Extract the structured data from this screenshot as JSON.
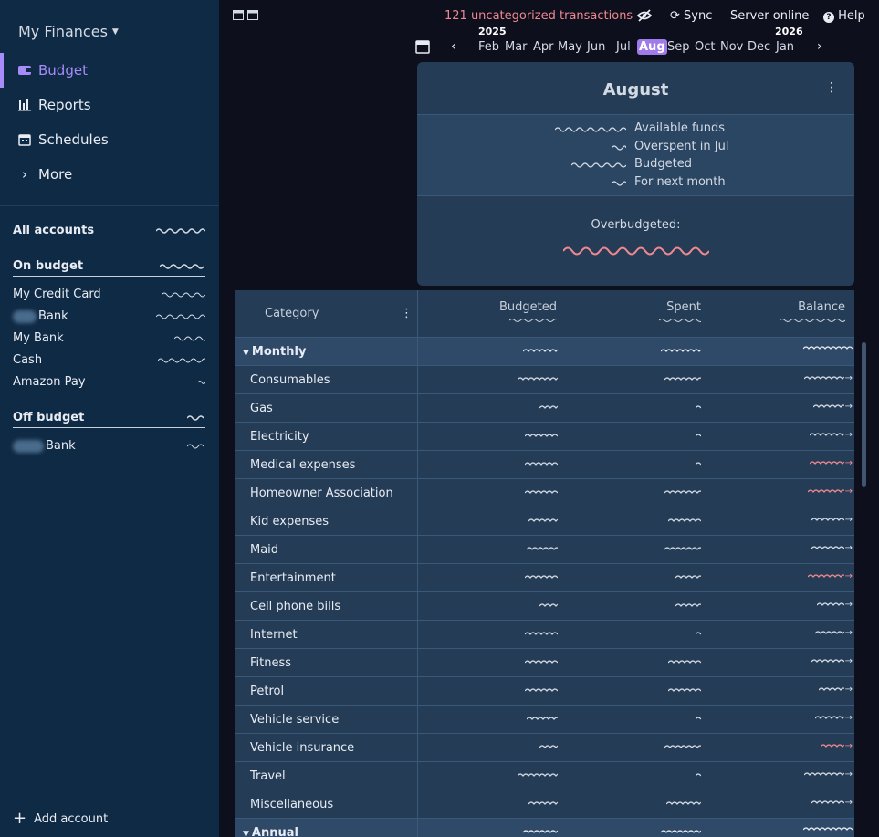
{
  "app": {
    "title": "My Finances"
  },
  "sidebar": {
    "nav": [
      {
        "label": "Budget",
        "icon": "wallet-icon",
        "active": true
      },
      {
        "label": "Reports",
        "icon": "chart-icon",
        "active": false
      },
      {
        "label": "Schedules",
        "icon": "calendar-icon",
        "active": false
      },
      {
        "label": "More",
        "icon": "chevron-right-icon",
        "active": false
      }
    ],
    "all_accounts": "All accounts",
    "on_budget": "On budget",
    "off_budget": "Off budget",
    "on_budget_accounts": [
      "My Credit Card",
      "Bank",
      "My Bank",
      "Cash",
      "Amazon Pay"
    ],
    "off_budget_accounts": [
      "Bank"
    ],
    "add_account": "Add account"
  },
  "topbar": {
    "uncategorized": "121 uncategorized transactions",
    "sync": "Sync",
    "server": "Server online",
    "help": "Help"
  },
  "months": {
    "year_left": "2025",
    "year_right": "2026",
    "list": [
      "Feb",
      "Mar",
      "Apr",
      "May",
      "Jun",
      "Jul",
      "Aug",
      "Sep",
      "Oct",
      "Nov",
      "Dec",
      "Jan"
    ],
    "active": "Aug"
  },
  "summary": {
    "title": "August",
    "lines": [
      "Available funds",
      "Overspent in Jul",
      "Budgeted",
      "For next month"
    ],
    "overbudgeted": "Overbudgeted:"
  },
  "table": {
    "headers": {
      "category": "Category",
      "budgeted": "Budgeted",
      "spent": "Spent",
      "balance": "Balance"
    },
    "groups": [
      {
        "name": "Monthly",
        "categories": [
          {
            "name": "Consumables",
            "negative": false
          },
          {
            "name": "Gas",
            "negative": false
          },
          {
            "name": "Electricity",
            "negative": false
          },
          {
            "name": "Medical expenses",
            "negative": true
          },
          {
            "name": "Homeowner Association",
            "negative": true
          },
          {
            "name": "Kid expenses",
            "negative": false
          },
          {
            "name": "Maid",
            "negative": false
          },
          {
            "name": "Entertainment",
            "negative": true
          },
          {
            "name": "Cell phone bills",
            "negative": false
          },
          {
            "name": "Internet",
            "negative": false
          },
          {
            "name": "Fitness",
            "negative": false
          },
          {
            "name": "Petrol",
            "negative": false
          },
          {
            "name": "Vehicle service",
            "negative": false
          },
          {
            "name": "Vehicle insurance",
            "negative": true
          },
          {
            "name": "Travel",
            "negative": false
          },
          {
            "name": "Miscellaneous",
            "negative": false
          }
        ]
      },
      {
        "name": "Annual",
        "categories": []
      }
    ]
  },
  "colors": {
    "accent": "#a78bfa",
    "negative": "#f08890",
    "sidebar": "#0f2a45",
    "panel": "#243c56"
  }
}
